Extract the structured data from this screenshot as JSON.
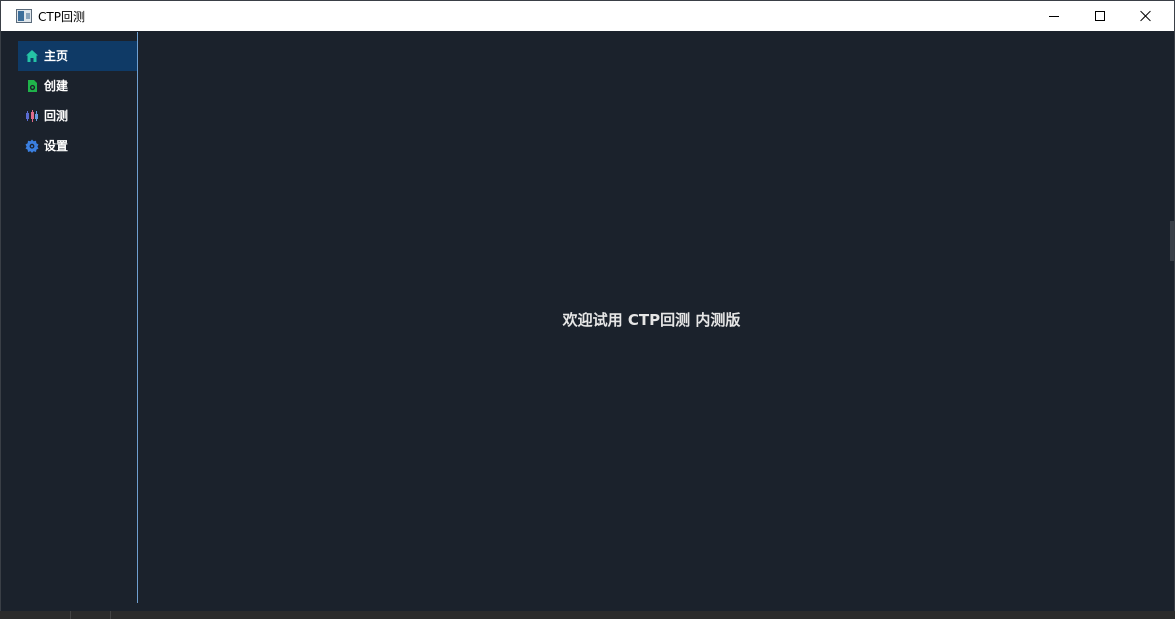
{
  "window": {
    "title": "CTP回测"
  },
  "sidebar": {
    "items": [
      {
        "label": "主页",
        "icon": "home-icon",
        "active": true,
        "icon_color": "#25c4a6"
      },
      {
        "label": "创建",
        "icon": "create-file-icon",
        "active": false,
        "icon_color": "#1fb34a"
      },
      {
        "label": "回测",
        "icon": "candlestick-icon",
        "active": false,
        "icon_color": "#6a78d8"
      },
      {
        "label": "设置",
        "icon": "gear-icon",
        "active": false,
        "icon_color": "#3a7fe0"
      }
    ]
  },
  "main": {
    "welcome_text": "欢迎试用 CTP回测 内测版"
  },
  "colors": {
    "background": "#1b222c",
    "active_item": "#0f3a66",
    "sidebar_border": "#6f9fd0",
    "text": "#ffffff"
  }
}
